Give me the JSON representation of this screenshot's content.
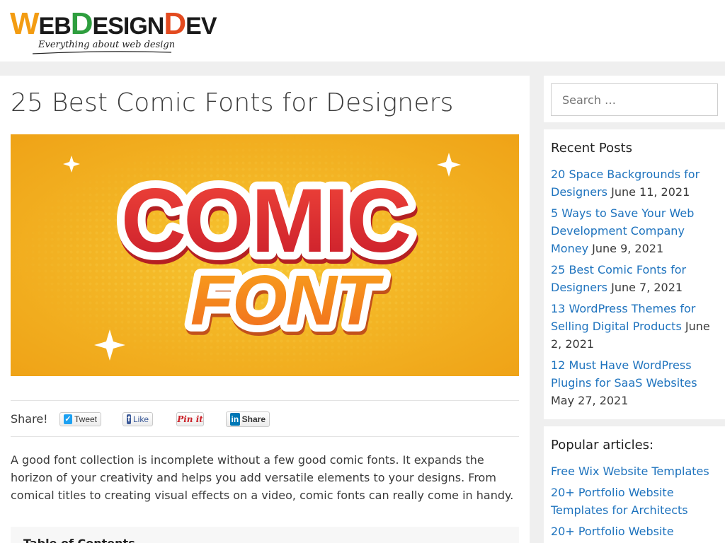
{
  "header": {
    "logo_letters": [
      {
        "t": "W",
        "c": "#f39c12"
      },
      {
        "t": "EB",
        "c": "#1a1a1a"
      },
      {
        "t": "D",
        "c": "#2e9e3e"
      },
      {
        "t": "ESIGN",
        "c": "#1a1a1a"
      },
      {
        "t": "D",
        "c": "#e34a1f"
      },
      {
        "t": "EV",
        "c": "#1a1a1a"
      }
    ],
    "tagline": "Everything about web design"
  },
  "article": {
    "title": "25 Best Comic Fonts for Designers",
    "hero": {
      "line1": "COMIC",
      "line2": "FONT"
    },
    "share": {
      "label": "Share!",
      "tweet": "Tweet",
      "like": "Like",
      "pin": "Pin it",
      "linkedin": "Share"
    },
    "intro": "A good font collection is incomplete without a few good comic fonts. It expands the horizon of your creativity and helps you add versatile elements to your designs. From comical titles to creating visual effects on a video, comic fonts can really come in handy.",
    "toc_title": "Table of Contents"
  },
  "sidebar": {
    "search": {
      "placeholder": "Search …"
    },
    "recent": {
      "title": "Recent Posts",
      "items": [
        {
          "title": "20 Space Backgrounds for Designers",
          "date": "June 11, 2021"
        },
        {
          "title": "5 Ways to Save Your Web Development Company Money",
          "date": "June 9, 2021"
        },
        {
          "title": "25 Best Comic Fonts for Designers",
          "date": "June 7, 2021"
        },
        {
          "title": "13 WordPress Themes for Selling Digital Products",
          "date": "June 2, 2021"
        },
        {
          "title": "12 Must Have WordPress Plugins for SaaS Websites",
          "date": "May 27, 2021"
        }
      ]
    },
    "popular": {
      "title": "Popular articles:",
      "items": [
        {
          "title": "Free Wix Website Templates"
        },
        {
          "title": "20+ Portfolio Website Templates for Architects"
        },
        {
          "title": "20+ Portfolio Website"
        }
      ]
    }
  },
  "colors": {
    "link": "#1e73be",
    "hero_bg": "#f2b01e",
    "hero_text_red": "#d8262b",
    "hero_text_orange": "#f57d1f"
  },
  "icons": [
    "twitter-bird-icon",
    "facebook-icon",
    "linkedin-icon"
  ]
}
